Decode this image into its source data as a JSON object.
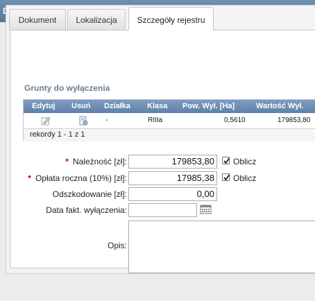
{
  "window": {
    "title": "Dokument i rejestr"
  },
  "tabs": [
    {
      "label": "Dokument",
      "active": false
    },
    {
      "label": "Lokalizacja",
      "active": false
    },
    {
      "label": "Szczegóły rejestru",
      "active": true
    }
  ],
  "section": {
    "title": "Grunty do wyłączenia"
  },
  "grid": {
    "columns": [
      "Edytuj",
      "Usuń",
      "Działka",
      "Klasa",
      "Pow. Wył. [Ha]",
      "Wartość Wył."
    ],
    "rows": [
      {
        "edit_icon": "edit-pencil-icon",
        "delete_icon": "delete-icon",
        "dzialka": "-",
        "klasa": "RIIIa",
        "pow": "0,5610",
        "wartosc": "179853,80"
      }
    ],
    "footer": "rekordy 1 - 1 z 1"
  },
  "form": {
    "naleznosc": {
      "label": "Należność [zł]:",
      "value": "179853,80",
      "required": true,
      "checkbox_label": "Oblicz",
      "checked": true
    },
    "oplata": {
      "label": "Opłata roczna (10%) [zł]:",
      "value": "17985,38",
      "required": true,
      "checkbox_label": "Oblicz",
      "checked": true
    },
    "odszkodowanie": {
      "label": "Odszkodowanie [zł]:",
      "value": "0,00"
    },
    "data_fakt": {
      "label": "Data fakt. wyłączenia:",
      "value": "",
      "icon": "calendar-icon"
    },
    "opis": {
      "label": "Opis:",
      "value": ""
    }
  },
  "colors": {
    "titlebar": "#5f81aa",
    "grid_header": "#6f8fb6",
    "required_star": "#b00000",
    "section_title": "#6d7f8e"
  }
}
